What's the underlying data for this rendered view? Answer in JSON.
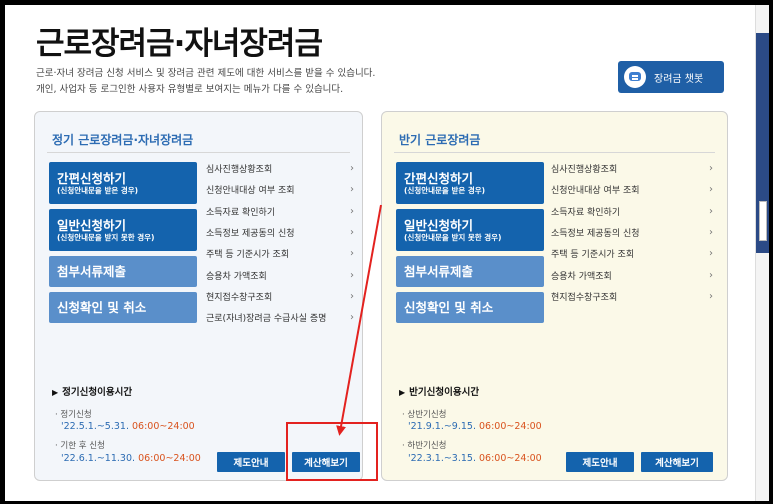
{
  "page": {
    "title": "근로장려금·자녀장려금",
    "desc_line1": "근로·자녀 장려금 신청 서비스 및 장려금 관련 제도에 대한 서비스를 받을 수 있습니다.",
    "desc_line2": "개인, 사업자 등 로그인한 사용자 유형별로 보여지는 메뉴가 다를 수 있습니다.",
    "chatbot_label": "장려금 챗봇"
  },
  "colors": {
    "primary": "#1463ad",
    "accent": "#d9531e",
    "highlight": "#e3221f"
  },
  "regular": {
    "title": "정기 근로장려금·자녀장려금",
    "buttons": {
      "simple": {
        "label": "간편신청하기",
        "sub": "(신청안내문을 받은 경우)"
      },
      "general": {
        "label": "일반신청하기",
        "sub": "(신청안내문을 받지 못한 경우)"
      },
      "attach": {
        "label": "첨부서류제출"
      },
      "cancel": {
        "label": "신청확인 및 취소"
      }
    },
    "menu": [
      "심사진행상황조회",
      "신청안내대상 여부 조회",
      "소득자료 확인하기",
      "소득정보 제공동의 신청",
      "주택 등 기준시가 조회",
      "승용차 가액조회",
      "현지접수창구조회",
      "근로(자녀)장려금 수급사실 증명"
    ],
    "time_head": "정기신청이용시간",
    "period1_label": "· 정기신청",
    "period1_date": "'22.5.1.~5.31.",
    "period1_time": "06:00~24:00",
    "period2_label": "· 기한 후 신청",
    "period2_date": "'22.6.1.~11.30.",
    "period2_time": "06:00~24:00",
    "btn_guide": "제도안내",
    "btn_calc": "계산해보기"
  },
  "half": {
    "title": "반기 근로장려금",
    "buttons": {
      "simple": {
        "label": "간편신청하기",
        "sub": "(신청안내문을 받은 경우)"
      },
      "general": {
        "label": "일반신청하기",
        "sub": "(신청안내문을 받지 못한 경우)"
      },
      "attach": {
        "label": "첨부서류제출"
      },
      "cancel": {
        "label": "신청확인 및 취소"
      }
    },
    "menu": [
      "심사진행상황조회",
      "신청안내대상 여부 조회",
      "소득자료 확인하기",
      "소득정보 제공동의 신청",
      "주택 등 기준시가 조회",
      "승용차 가액조회",
      "현지접수창구조회"
    ],
    "time_head": "반기신청이용시간",
    "period1_label": "· 상반기신청",
    "period1_date": "'21.9.1.~9.15.",
    "period1_time": "06:00~24:00",
    "period2_label": "· 하반기신청",
    "period2_date": "'22.3.1.~3.15.",
    "period2_time": "06:00~24:00",
    "btn_guide": "제도안내",
    "btn_calc": "계산해보기"
  }
}
